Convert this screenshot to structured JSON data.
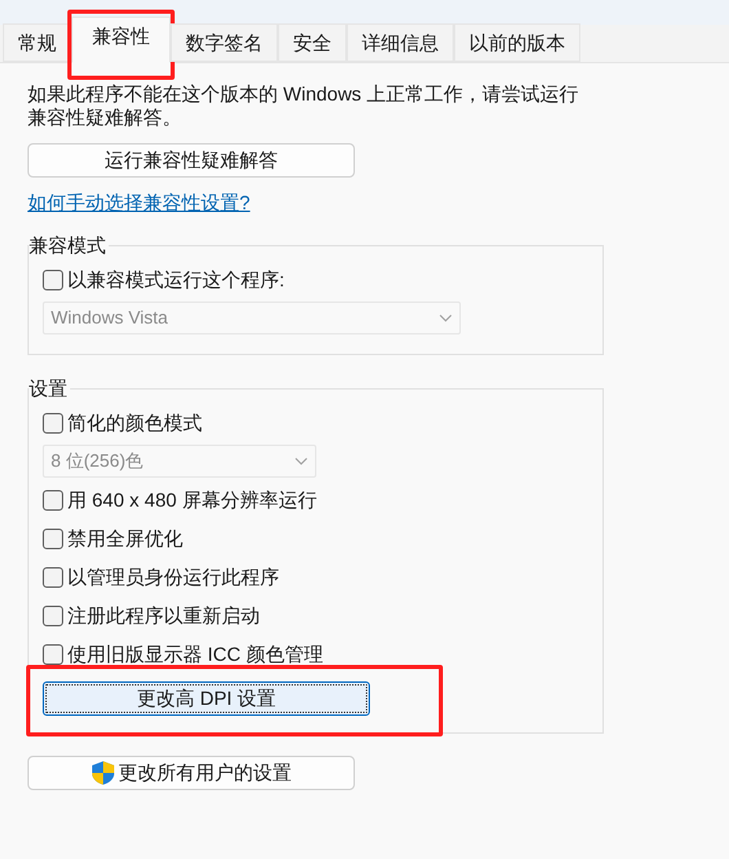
{
  "tabs": [
    {
      "label": "常规",
      "selected": false,
      "highlighted": false
    },
    {
      "label": "兼容性",
      "selected": true,
      "highlighted": true
    },
    {
      "label": "数字签名",
      "selected": false,
      "highlighted": false
    },
    {
      "label": "安全",
      "selected": false,
      "highlighted": false
    },
    {
      "label": "详细信息",
      "selected": false,
      "highlighted": false
    },
    {
      "label": "以前的版本",
      "selected": false,
      "highlighted": false
    }
  ],
  "intro": "如果此程序不能在这个版本的 Windows 上正常工作，请尝试运行兼容性疑难解答。",
  "troubleshoot_button": "运行兼容性疑难解答",
  "help_link": "如何手动选择兼容性设置?",
  "compat_group": {
    "title": "兼容模式",
    "items": [
      {
        "kind": "checkbox",
        "label": "以兼容模式运行这个程序:",
        "checked": false
      },
      {
        "kind": "dropdown",
        "value": "Windows Vista",
        "disabled": true
      }
    ]
  },
  "settings_group": {
    "title": "设置",
    "items": [
      {
        "kind": "checkbox",
        "label": "简化的颜色模式",
        "checked": false
      },
      {
        "kind": "dropdown",
        "value": "8 位(256)色",
        "disabled": true
      },
      {
        "kind": "checkbox",
        "label": "用 640 x 480 屏幕分辨率运行",
        "checked": false
      },
      {
        "kind": "checkbox",
        "label": "禁用全屏优化",
        "checked": false
      },
      {
        "kind": "checkbox",
        "label": "以管理员身份运行此程序",
        "checked": false
      },
      {
        "kind": "checkbox",
        "label": "注册此程序以重新启动",
        "checked": false
      },
      {
        "kind": "checkbox",
        "label": "使用旧版显示器 ICC 颜色管理",
        "checked": false
      }
    ],
    "dpi_button": {
      "label": "更改高 DPI 设置",
      "focused": true,
      "highlighted": true
    }
  },
  "all_users_button": "更改所有用户的设置"
}
